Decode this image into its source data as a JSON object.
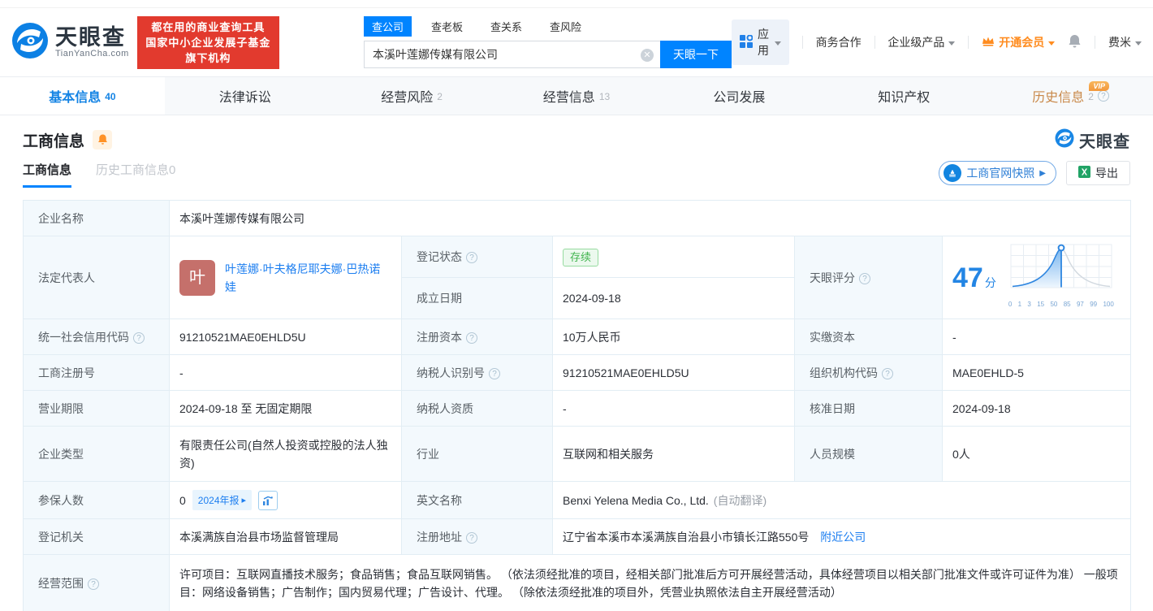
{
  "brand": {
    "name": "天眼查",
    "domain": "TianYanCha.com",
    "slogan_line1": "都在用的商业查询工具",
    "slogan_line2": "国家中小企业发展子基金旗下机构"
  },
  "search": {
    "tabs": [
      "查公司",
      "查老板",
      "查关系",
      "查风险"
    ],
    "active_tab": "查公司",
    "value": "本溪叶莲娜传媒有限公司",
    "submit_label": "天眼一下"
  },
  "topmenu": {
    "apps": "应用",
    "cooperation": "商务合作",
    "enterprise_products": "企业级产品",
    "vip": "开通会员",
    "username": "费米"
  },
  "nav": {
    "vip_badge": "VIP",
    "tabs": [
      {
        "label": "基本信息",
        "count": "40",
        "active": true
      },
      {
        "label": "法律诉讼",
        "count": "",
        "active": false
      },
      {
        "label": "经营风险",
        "count": "2",
        "active": false
      },
      {
        "label": "经营信息",
        "count": "13",
        "active": false
      },
      {
        "label": "公司发展",
        "count": "",
        "active": false
      },
      {
        "label": "知识产权",
        "count": "",
        "active": false
      },
      {
        "label": "历史信息",
        "count": "2",
        "active": false,
        "vip": true
      }
    ]
  },
  "section": {
    "title": "工商信息",
    "subtab_active": "工商信息",
    "subtab_history": "历史工商信息0",
    "snapshot_button": "工商官网快照",
    "export_button": "导出",
    "watermark": "天眼查"
  },
  "table": {
    "company_name": {
      "label": "企业名称",
      "value": "本溪叶莲娜传媒有限公司"
    },
    "legal_rep": {
      "label": "法定代表人",
      "avatar": "叶",
      "name": "叶莲娜·叶夫格尼耶夫娜·巴热诺娃"
    },
    "reg_status": {
      "label": "登记状态",
      "value": "存续"
    },
    "establish_date": {
      "label": "成立日期",
      "value": "2024-09-18"
    },
    "score": {
      "label": "天眼评分",
      "value": "47",
      "unit": "分"
    },
    "credit_code": {
      "label": "统一社会信用代码",
      "value": "91210521MAE0EHLD5U"
    },
    "reg_capital": {
      "label": "注册资本",
      "value": "10万人民币"
    },
    "paid_capital": {
      "label": "实缴资本",
      "value": "-"
    },
    "reg_no": {
      "label": "工商注册号",
      "value": "-"
    },
    "taxpayer_id": {
      "label": "纳税人识别号",
      "value": "91210521MAE0EHLD5U"
    },
    "org_code": {
      "label": "组织机构代码",
      "value": "MAE0EHLD-5"
    },
    "term": {
      "label": "营业期限",
      "value": "2024-09-18 至 无固定期限"
    },
    "taxpayer_qual": {
      "label": "纳税人资质",
      "value": "-"
    },
    "approval_date": {
      "label": "核准日期",
      "value": "2024-09-18"
    },
    "company_type": {
      "label": "企业类型",
      "value": "有限责任公司(自然人投资或控股的法人独资)"
    },
    "industry": {
      "label": "行业",
      "value": "互联网和相关服务"
    },
    "staff_size": {
      "label": "人员规模",
      "value": "0人"
    },
    "insured": {
      "label": "参保人数",
      "value": "0",
      "badge": "2024年报"
    },
    "english_name": {
      "label": "英文名称",
      "value": "Benxi Yelena Media Co., Ltd.",
      "note": "(自动翻译)"
    },
    "registry": {
      "label": "登记机关",
      "value": "本溪满族自治县市场监督管理局"
    },
    "address": {
      "label": "注册地址",
      "value": "辽宁省本溪市本溪满族自治县小市镇长江路550号",
      "link": "附近公司"
    },
    "scope": {
      "label": "经营范围",
      "value": "许可项目：互联网直播技术服务；食品销售；食品互联网销售。 （依法须经批准的项目，经相关部门批准后方可开展经营活动，具体经营项目以相关部门批准文件或许可证件为准） 一般项目：网络设备销售；广告制作；国内贸易代理；广告设计、代理。 （除依法须经批准的项目外，凭营业执照依法自主开展经营活动）"
    }
  },
  "chart_data": {
    "type": "area",
    "title": "天眼评分分布曲线",
    "score": 47,
    "x_ticks": [
      0,
      1,
      3,
      15,
      50,
      85,
      97,
      99,
      100
    ],
    "marker_percentile": 50,
    "curve": "normal-distribution",
    "fill_region": "left-of-marker",
    "grid": true
  },
  "colors": {
    "accent_blue": "#0084ff",
    "brand_red": "#e23a2e",
    "vip_orange": "#ff8c1f",
    "status_green": "#41b44e",
    "score_blue": "#2385e4"
  }
}
